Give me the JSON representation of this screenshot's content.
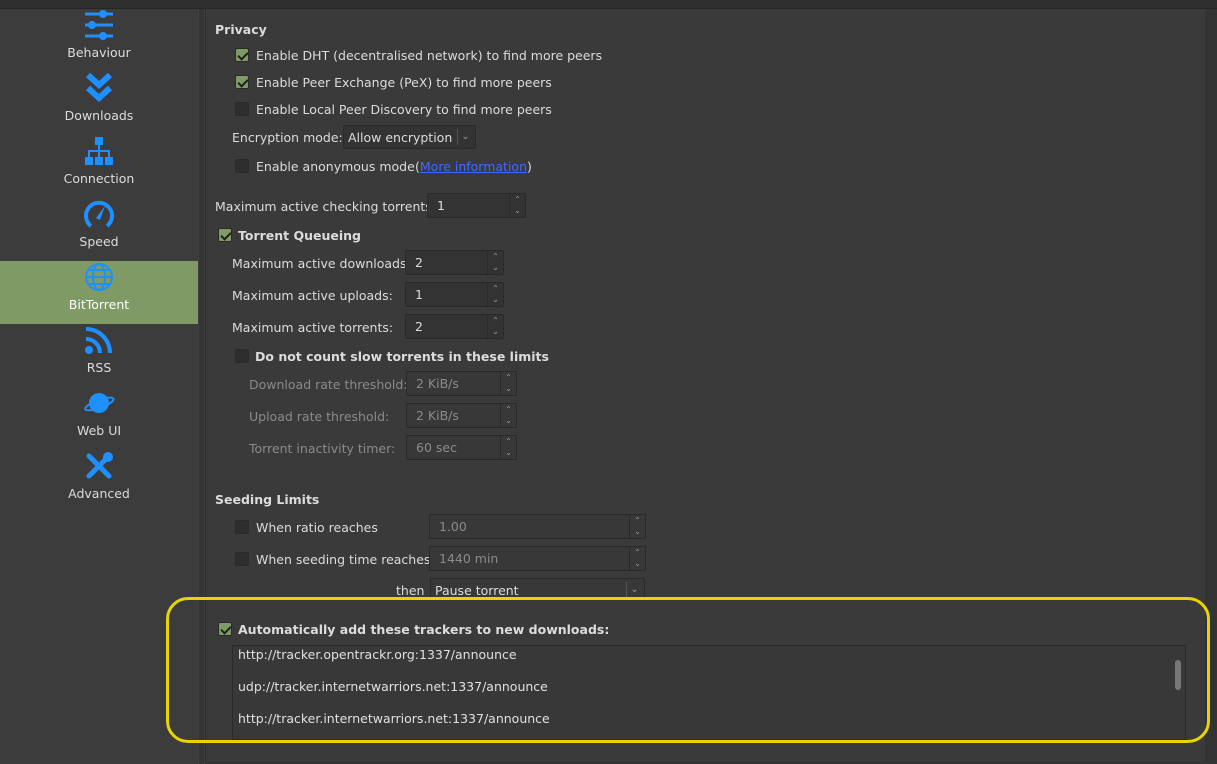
{
  "sidebar": {
    "items": [
      {
        "label": "Behaviour",
        "icon": "sliders-icon"
      },
      {
        "label": "Downloads",
        "icon": "double-chevron-down-icon"
      },
      {
        "label": "Connection",
        "icon": "network-icon"
      },
      {
        "label": "Speed",
        "icon": "speedometer-icon"
      },
      {
        "label": "BitTorrent",
        "icon": "globe-icon",
        "selected": true
      },
      {
        "label": "RSS",
        "icon": "rss-icon"
      },
      {
        "label": "Web UI",
        "icon": "planet-icon"
      },
      {
        "label": "Advanced",
        "icon": "tools-icon"
      }
    ]
  },
  "colors": {
    "accent": "#7f9a64",
    "icon": "#1e90ff",
    "highlight": "#e8d400"
  },
  "privacy": {
    "title": "Privacy",
    "dht": {
      "label": "Enable DHT (decentralised network) to find more peers",
      "checked": true
    },
    "pex": {
      "label": "Enable Peer Exchange (PeX) to find more peers",
      "checked": true
    },
    "lpd": {
      "label": "Enable Local Peer Discovery to find more peers",
      "checked": false
    },
    "encryption_label": "Encryption mode:",
    "encryption_value": "Allow encryption",
    "anon": {
      "label": "Enable anonymous mode",
      "checked": false
    },
    "more_info_open": "(",
    "more_info": "More information",
    "more_info_close": ")"
  },
  "checking": {
    "label": "Maximum active checking torrents:",
    "value": "1"
  },
  "queueing": {
    "label": "Torrent Queueing",
    "checked": true,
    "downloads_label": "Maximum active downloads:",
    "downloads": "2",
    "uploads_label": "Maximum active uploads:",
    "uploads": "1",
    "torrents_label": "Maximum active torrents:",
    "torrents": "2",
    "slow_label": "Do not count slow torrents in these limits",
    "slow_checked": false,
    "dl_thresh_label": "Download rate threshold:",
    "dl_thresh": "2 KiB/s",
    "ul_thresh_label": "Upload rate threshold:",
    "ul_thresh": "2 KiB/s",
    "inactivity_label": "Torrent inactivity timer:",
    "inactivity": "60 sec"
  },
  "seeding": {
    "title": "Seeding Limits",
    "ratio_label": "When ratio reaches",
    "ratio": "1.00",
    "ratio_checked": false,
    "time_label": "When seeding time reaches",
    "time": "1440 min",
    "time_checked": false,
    "then_label": "then",
    "action": "Pause torrent"
  },
  "trackers": {
    "label": "Automatically add these trackers to new downloads:",
    "checked": true,
    "list": [
      "http://tracker.opentrackr.org:1337/announce",
      "udp://tracker.internetwarriors.net:1337/announce",
      "http://tracker.internetwarriors.net:1337/announce"
    ]
  }
}
